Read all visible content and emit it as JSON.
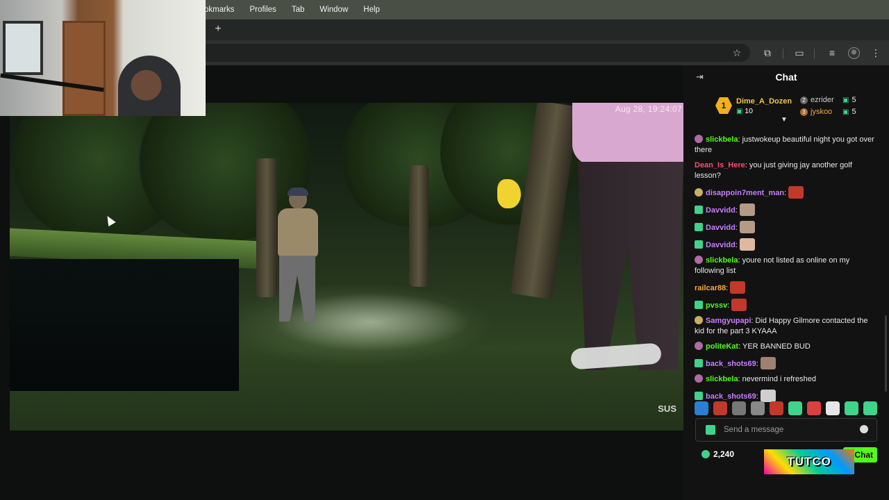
{
  "menubar": {
    "items": [
      "okmarks",
      "Profiles",
      "Tab",
      "Window",
      "Help"
    ]
  },
  "browser": {
    "new_tab": "+"
  },
  "video": {
    "timestamp": "Aug 28, 19:24:07",
    "watermark": "SUS"
  },
  "chat": {
    "title": "Chat",
    "leaderboard": {
      "first": {
        "rank": "1",
        "name": "Dime_A_Dozen",
        "score": "10"
      },
      "others": [
        {
          "rank": "2",
          "name": "ezrider",
          "score": "5",
          "color": "#cfcfcf"
        },
        {
          "rank": "3",
          "name": "jyskoo",
          "score": "5",
          "color": "#f2a93b"
        }
      ]
    },
    "messages": [
      {
        "user": "slickbela",
        "color": "#53fc18",
        "badge": "pin",
        "text": ": justwokeup beautiful night you got over there"
      },
      {
        "user": "Dean_Is_Here",
        "color": "#ff4d6d",
        "badge": "",
        "text": ": you just giving jay another golf lesson?"
      },
      {
        "user": "disappoin7ment_man",
        "color": "#c77dff",
        "badge": "emo",
        "text": ":",
        "emote": "#c0392b"
      },
      {
        "user": "Davvidd",
        "color": "#c77dff",
        "badge": "sub",
        "text": ":",
        "emote": "#b59a86"
      },
      {
        "user": "Davvidd",
        "color": "#c77dff",
        "badge": "sub",
        "text": ":",
        "emote": "#b59a86"
      },
      {
        "user": "Davvidd",
        "color": "#c77dff",
        "badge": "sub",
        "text": ":",
        "emote": "#e0b8a0"
      },
      {
        "user": "slickbela",
        "color": "#53fc18",
        "badge": "pin",
        "text": ": youre not listed as online on my following list"
      },
      {
        "user": "railcar88",
        "color": "#f2a93b",
        "badge": "",
        "text": ":",
        "emote": "#c0392b"
      },
      {
        "user": "pvssv",
        "color": "#53fc18",
        "badge": "sub",
        "text": ":",
        "emote": "#c0392b"
      },
      {
        "user": "Samgyupapi",
        "color": "#c77dff",
        "badge": "emo",
        "text": ": Did Happy Gilmore contacted the kid for the part 3 KYAAA"
      },
      {
        "user": "politeKat",
        "color": "#53fc18",
        "badge": "pin",
        "text": ": YER BANNED BUD"
      },
      {
        "user": "back_shots69",
        "color": "#c77dff",
        "badge": "sub",
        "text": ":",
        "emote": "#a08070"
      },
      {
        "user": "slickbela",
        "color": "#53fc18",
        "badge": "pin",
        "text": ": nevermind i refreshed"
      },
      {
        "user": "back_shots69",
        "color": "#c77dff",
        "badge": "sub",
        "text": ":",
        "emote": "#cfcfcf"
      }
    ],
    "emote_bar": [
      "#2a7fd4",
      "#c0392b",
      "#777",
      "#888",
      "#c0392b",
      "#3fd48a",
      "#d94040",
      "#e6e6e6",
      "#3fd48a",
      "#3fd48a"
    ],
    "input_placeholder": "Send a message",
    "points": "2,240",
    "send_label": "Chat",
    "overlay_logo": "TUTCO"
  }
}
